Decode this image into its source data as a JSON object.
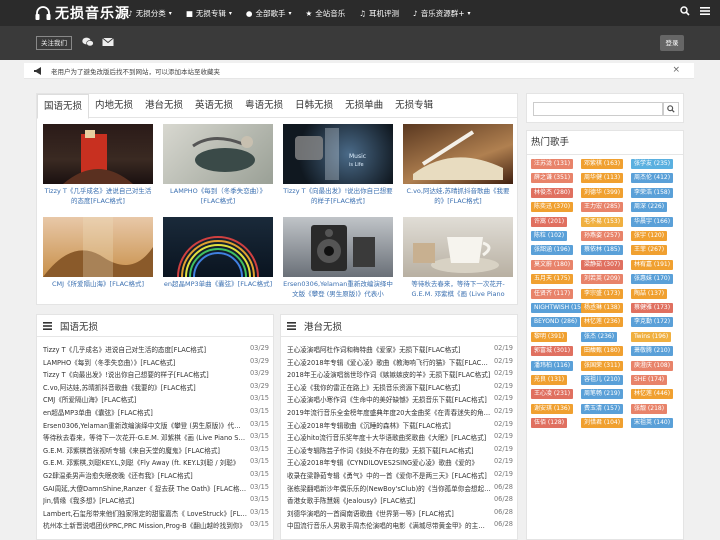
{
  "header": {
    "logo_text": "无损音乐源",
    "nav": [
      {
        "label": "无损分类",
        "caret": "▾"
      },
      {
        "label": "无损专辑",
        "caret": "▾"
      },
      {
        "label": "全部歌手",
        "caret": "▾"
      },
      {
        "label": "全站音乐",
        "caret": ""
      },
      {
        "label": "耳机评测",
        "caret": ""
      },
      {
        "label": "音乐资源群+",
        "caret": "▾"
      }
    ]
  },
  "subbar": {
    "follow_label": "关注我们",
    "login_label": "登录"
  },
  "notice": {
    "text": "老用户为了避免改版后找不到网站，可以添加本站至收藏夹",
    "close": "×"
  },
  "tabs": [
    "国语无损",
    "内地无损",
    "港台无损",
    "英语无损",
    "粤语无损",
    "日韩无损",
    "无损单曲",
    "无损专辑"
  ],
  "cards": [
    {
      "caption": "Tizzy T《几乎成名》进说自己对生活的态度[FLAC格式]"
    },
    {
      "caption": "LAMPHO《每到（冬季失恋曲）》[FLAC格式]"
    },
    {
      "caption": "Tizzy T《向最出发》!说出你自己想要的样子[FLAC格式]"
    },
    {
      "caption": "C.vo,阿达娃,苏晴抓抖音歌曲《我要的》[FLAC格式]"
    },
    {
      "caption": "CMJ《所爱隔山海》[FLAC格式]"
    },
    {
      "caption": "en超晶MP3单曲《囊弦》[FLAC格式]"
    },
    {
      "caption": "Ersen0306,Yelaman重新改编演绎中文版《攀登 (男生原版)》代表小"
    },
    {
      "caption": "等待秋去春来，等待下一次花开-G.E.M. 邓紫棋《画 (Live Piano"
    }
  ],
  "left_list": {
    "title": "国语无损",
    "rows": [
      {
        "t": "Tizzy T《几乎成名》进说自己对生活的态度[FLAC格式]",
        "d": "03/29"
      },
      {
        "t": "LAMPHO《每到（冬季失恋曲）》[FLAC格式]",
        "d": "03/29"
      },
      {
        "t": "Tizzy T《向最出发》!说出你自己想要的样子[FLAC格式]",
        "d": "03/29"
      },
      {
        "t": "C.vo,阿达娃,苏晴抓抖音歌曲《我要的》[FLAC格式]",
        "d": "03/29"
      },
      {
        "t": "CMJ《所爱隔山海》[FLAC格式]",
        "d": "03/15"
      },
      {
        "t": "en超晶MP3单曲《囊弦》[FLAC格式]",
        "d": "03/15"
      },
      {
        "t": "Ersen0306,Yelaman重新改编演绎中文版《攀登 (男生原版)》代表小",
        "d": "03/15"
      },
      {
        "t": "等待秋去春来，等待下一次花开-G.E.M. 邓紫棋《画 (Live Piano Session II)》",
        "d": "03/15"
      },
      {
        "t": "G.E.M. 邓紫棋首张视听专辑《来自天堂的魔鬼》[FLAC格式]",
        "d": "03/15"
      },
      {
        "t": "G.E.M. 邓紫棋,刘聪KEY.L,刘聪《Fly Away (ft. KEY.L刘聪 / 刘聪》",
        "d": "03/15"
      },
      {
        "t": "G2肆温柔男声治愈失眠夜晚《还有我》[FLAC格式]",
        "d": "03/15"
      },
      {
        "t": "GAI周延,大傻DamnShine,Ranzer《 捉去获 The Oath》[FLAC格式]",
        "d": "03/15"
      },
      {
        "t": "Jin,情缘《我多想》[FLAC格式]",
        "d": "03/15"
      },
      {
        "t": "Lambert,石玺彤带来他们独家限定的甜蜜嘉杰《 LoveStruck》[FLAC格式]",
        "d": "03/15"
      },
      {
        "t": "杭州本土新晋说唱团伙PRC,PRC Mission,Prog-B《翻山越岭找到你》",
        "d": "03/15"
      }
    ]
  },
  "right_list": {
    "title": "港台无损",
    "rows": [
      {
        "t": "王心凌演唱阿杜作词和梅特曲《爱家》无损下载[FLAC格式]",
        "d": "02/19"
      },
      {
        "t": "王心凌2018年专辑《爱心凌》歌曲《教海响飞行的猫》下载[FLAC格式]",
        "d": "02/19"
      },
      {
        "t": "2018年王心凌演唱翁世珍作词《嫉嫉嫉皮的羊》无损下载[FLAC格式]",
        "d": "02/19"
      },
      {
        "t": "王心凌《我你的雷正在路上》无损音乐资源下载[FLAC格式]",
        "d": "02/19"
      },
      {
        "t": "王心凌演唱小寒作词《生命中的美好缺憾》无损音乐下载[FLAC格式]",
        "d": "02/19"
      },
      {
        "t": "2019年流行音乐全金榜年度盛典年度20大金曲奖《在青春迷失的角落》",
        "d": "02/19"
      },
      {
        "t": "王心凌2018年专辑歌曲《沉睡的森林》下载[FLAC格式]",
        "d": "02/19"
      },
      {
        "t": "王心凌hito流行音乐奖年度十大华语歌曲奖歌曲《大眠》[FLAC格式]",
        "d": "02/19"
      },
      {
        "t": "王心凌专辑陈芸子作词《刻处不存在的我》无损下载[FLAC格式]",
        "d": "02/19"
      },
      {
        "t": "王心凌2018年专辑《CYNDILOVES2SING爱心凌》歌曲《爱的》",
        "d": "02/19"
      },
      {
        "t": "收录在梁静茹专辑《勇气》中的一首《爱你不是两三天》[FLAC格式]",
        "d": "02/19"
      },
      {
        "t": "张栋梁翻唱新沙年偶乐乐的(NewBoy'sClub)的《当你孤单你会想起谁》",
        "d": "06/28"
      },
      {
        "t": "香港女歌手陈慧娴《Jealousy》[FLAC格式]",
        "d": "06/28"
      },
      {
        "t": "刘德华演唱的一首闽南语歌曲《世界第一等》[FLAC格式]",
        "d": "06/28"
      },
      {
        "t": "中国流行音乐人男歌手周杰伦演唱的电影《满城尽带黄金甲》的主题曲",
        "d": "06/28"
      }
    ]
  },
  "hot_singers": {
    "title": "热门歌手",
    "tags": [
      {
        "label": "汪苏泷 (131)",
        "color": "#e8836a"
      },
      {
        "label": "邓紫棋 (163)",
        "color": "#f0a030"
      },
      {
        "label": "张学友 (235)",
        "color": "#5ab0e0"
      },
      {
        "label": "薛之谦 (351)",
        "color": "#e8836a"
      },
      {
        "label": "周华健 (113)",
        "color": "#f0a030"
      },
      {
        "label": "周杰伦 (412)",
        "color": "#5aa0d8"
      },
      {
        "label": "林俊杰 (280)",
        "color": "#e07060"
      },
      {
        "label": "刘德华 (399)",
        "color": "#f0a030"
      },
      {
        "label": "李荣浩 (158)",
        "color": "#5aa0d8"
      },
      {
        "label": "陈奕迅 (370)",
        "color": "#f0a030"
      },
      {
        "label": "王力宏 (285)",
        "color": "#e8836a"
      },
      {
        "label": "周深 (226)",
        "color": "#5aa0d8"
      },
      {
        "label": "许嵩 (201)",
        "color": "#e07060"
      },
      {
        "label": "毛不易 (153)",
        "color": "#f0b040"
      },
      {
        "label": "华晨宇 (166)",
        "color": "#5aa0d8"
      },
      {
        "label": "陈粒 (102)",
        "color": "#5aa0d8"
      },
      {
        "label": "孙燕姿 (257)",
        "color": "#e8836a"
      },
      {
        "label": "张宇 (120)",
        "color": "#f0a030"
      },
      {
        "label": "张韶涵 (196)",
        "color": "#5aa0d8"
      },
      {
        "label": "蔡依林 (185)",
        "color": "#5aa0d8"
      },
      {
        "label": "王菲 (267)",
        "color": "#f0a030"
      },
      {
        "label": "莫文蔚 (180)",
        "color": "#e8836a"
      },
      {
        "label": "梁静茹 (307)",
        "color": "#e07060"
      },
      {
        "label": "林宥嘉 (191)",
        "color": "#f0a030"
      },
      {
        "label": "五月天 (175)",
        "color": "#f0a030"
      },
      {
        "label": "刘若英 (209)",
        "color": "#e8836a"
      },
      {
        "label": "张惠妹 (170)",
        "color": "#5aa0d8"
      },
      {
        "label": "任贤齐 (117)",
        "color": "#e8836a"
      },
      {
        "label": "李宗盛 (173)",
        "color": "#f0a030"
      },
      {
        "label": "陶喆 (137)",
        "color": "#f0a030"
      },
      {
        "label": "NIGHTWISH (154)",
        "color": "#5aa0d8"
      },
      {
        "label": "杨丞琳 (138)",
        "color": "#f0a030"
      },
      {
        "label": "蔡健雅 (173)",
        "color": "#e07060"
      },
      {
        "label": "BEYOND (286)",
        "color": "#5aa0d8"
      },
      {
        "label": "林忆莲 (236)",
        "color": "#f0a030"
      },
      {
        "label": "李克勤 (172)",
        "color": "#5aa0d8"
      },
      {
        "label": "黎明 (391)",
        "color": "#f0a030"
      },
      {
        "label": "张杰 (236)",
        "color": "#5aa0d8"
      },
      {
        "label": "Twins (196)",
        "color": "#f0b040"
      },
      {
        "label": "郭富城 (301)",
        "color": "#e07060"
      },
      {
        "label": "田馥甄 (180)",
        "color": "#f0a030"
      },
      {
        "label": "萧敬腾 (210)",
        "color": "#5aa0d8"
      },
      {
        "label": "潘玮柏 (116)",
        "color": "#5aa0d8"
      },
      {
        "label": "张国荣 (311)",
        "color": "#f0a030"
      },
      {
        "label": "庾澄庆 (108)",
        "color": "#e8836a"
      },
      {
        "label": "光良 (131)",
        "color": "#f0a030"
      },
      {
        "label": "容祖儿 (210)",
        "color": "#5aa0d8"
      },
      {
        "label": "SHE (174)",
        "color": "#e8836a"
      },
      {
        "label": "王心凌 (231)",
        "color": "#e07060"
      },
      {
        "label": "周笔畅 (219)",
        "color": "#5aa0d8"
      },
      {
        "label": "林忆莲 (446)",
        "color": "#f0a030"
      },
      {
        "label": "谢安琪 (136)",
        "color": "#f0a030"
      },
      {
        "label": "费玉清 (157)",
        "color": "#5aa0d8"
      },
      {
        "label": "张靓 (218)",
        "color": "#e8836a"
      },
      {
        "label": "伍佰 (128)",
        "color": "#e07060"
      },
      {
        "label": "刘惜君 (104)",
        "color": "#f0a030"
      },
      {
        "label": "宋祖英 (140)",
        "color": "#5aa0d8"
      }
    ]
  }
}
